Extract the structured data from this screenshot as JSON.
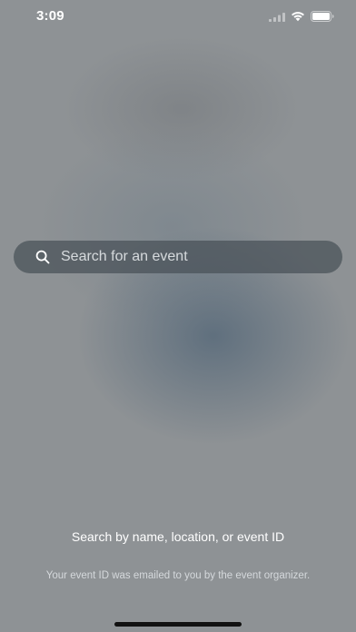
{
  "status_bar": {
    "time": "3:09",
    "icons": [
      "cellular-signal-icon",
      "wifi-icon",
      "battery-icon"
    ]
  },
  "search": {
    "placeholder": "Search for an event",
    "value": "",
    "icon": "search-icon"
  },
  "hint": {
    "title": "Search by name, location, or event ID",
    "subtitle": "Your event ID was emailed to you by the event organizer."
  },
  "colors": {
    "background": "#8e9295",
    "search_field": "#48505a",
    "text_primary": "#ffffff"
  }
}
